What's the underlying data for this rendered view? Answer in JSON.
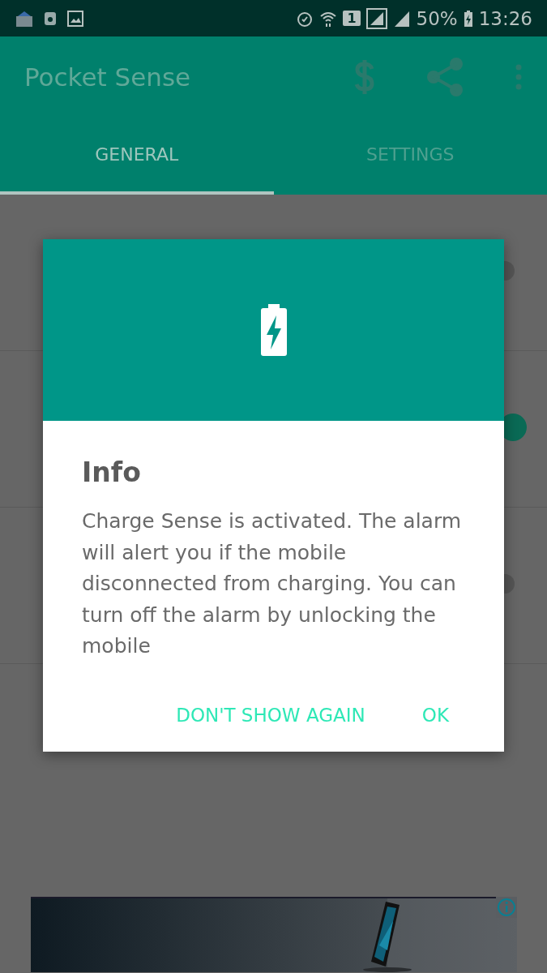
{
  "status_bar": {
    "sim_slot": "1",
    "battery": "50%",
    "time": "13:26"
  },
  "app_bar": {
    "title": "Pocket Sense"
  },
  "tabs": [
    {
      "label": "GENERAL",
      "selected": true
    },
    {
      "label": "SETTINGS",
      "selected": false
    }
  ],
  "settings_rows": [
    {
      "on": false
    },
    {
      "on": true
    },
    {
      "on": false
    }
  ],
  "dialog": {
    "title": "Info",
    "message": "Charge Sense is activated. The alarm will alert you if the mobile disconnected from charging. You can turn off the alarm by unlocking the mobile",
    "buttons": [
      "DON'T SHOW AGAIN",
      "OK"
    ]
  }
}
